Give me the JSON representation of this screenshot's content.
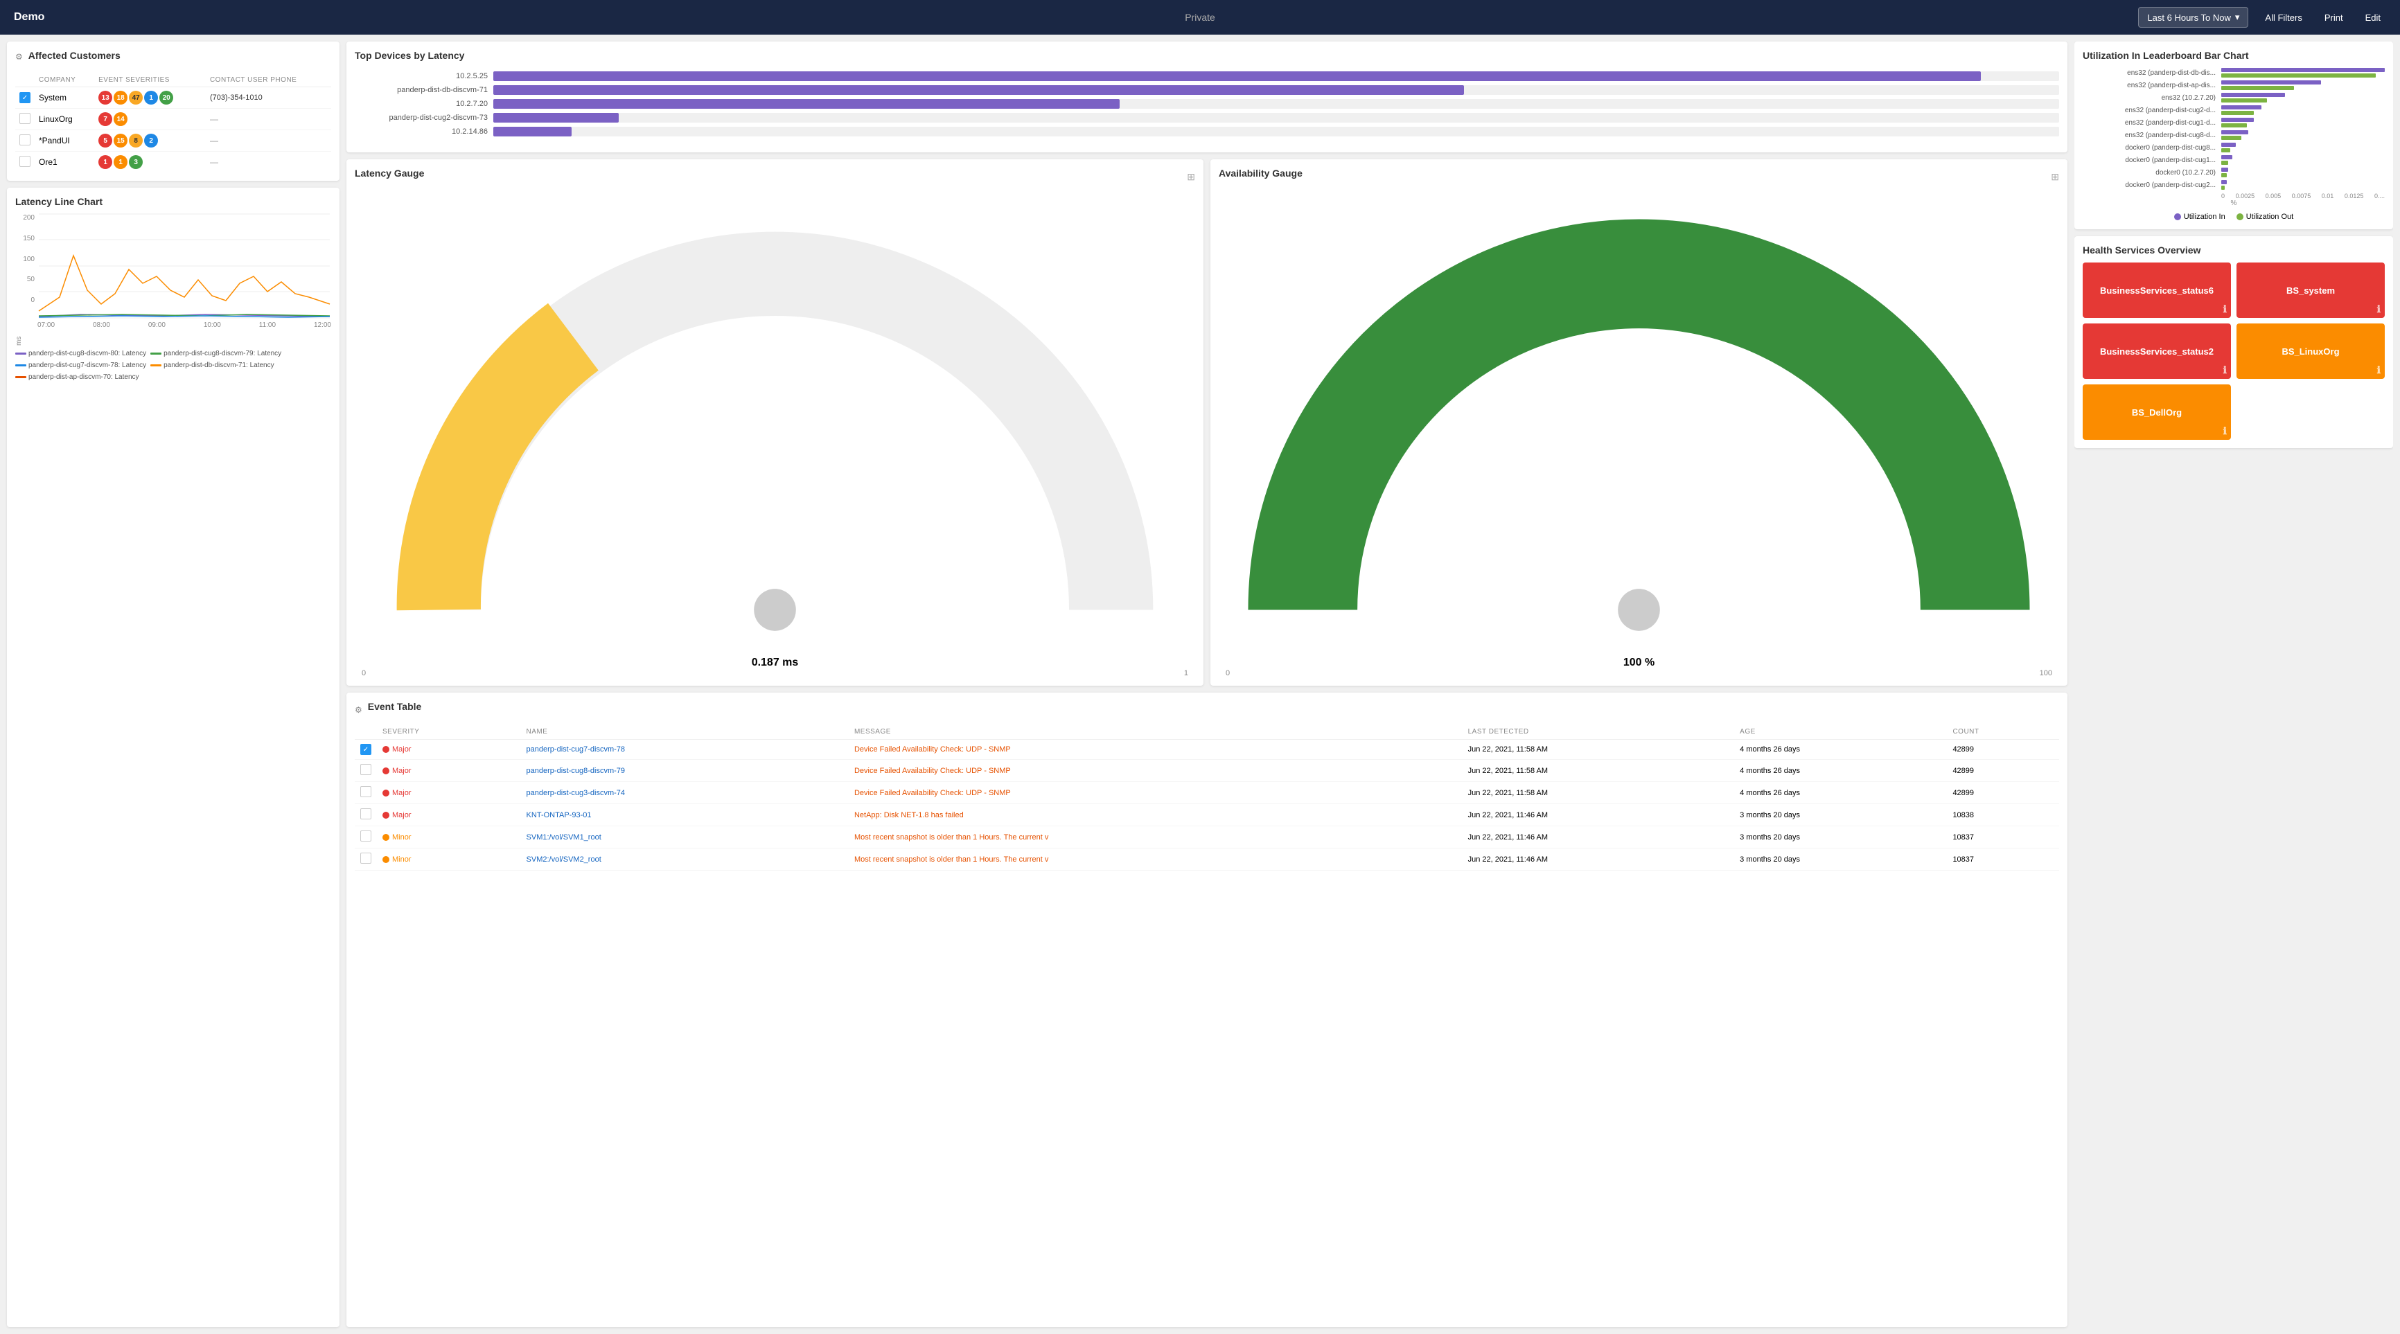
{
  "nav": {
    "title": "Demo",
    "private_label": "Private",
    "time_filter": "Last 6 Hours To Now",
    "all_filters": "All Filters",
    "print": "Print",
    "edit": "Edit"
  },
  "affected_customers": {
    "title": "Affected Customers",
    "columns": [
      "COMPANY",
      "EVENT SEVERITIES",
      "CONTACT USER PHONE"
    ],
    "rows": [
      {
        "checked": true,
        "company": "System",
        "badges": [
          {
            "count": "13",
            "color": "red"
          },
          {
            "count": "18",
            "color": "orange"
          },
          {
            "count": "47",
            "color": "yellow"
          },
          {
            "count": "1",
            "color": "blue"
          },
          {
            "count": "20",
            "color": "green"
          }
        ],
        "phone": "(703)-354-1010"
      },
      {
        "checked": false,
        "company": "LinuxOrg",
        "badges": [
          {
            "count": "7",
            "color": "red"
          },
          {
            "count": "14",
            "color": "orange"
          }
        ],
        "phone": "—"
      },
      {
        "checked": false,
        "company": "*PandUI",
        "badges": [
          {
            "count": "5",
            "color": "red"
          },
          {
            "count": "15",
            "color": "orange"
          },
          {
            "count": "8",
            "color": "yellow"
          },
          {
            "count": "2",
            "color": "blue"
          }
        ],
        "phone": "—"
      },
      {
        "checked": false,
        "company": "Ore1",
        "badges": [
          {
            "count": "1",
            "color": "red"
          },
          {
            "count": "1",
            "color": "orange"
          },
          {
            "count": "3",
            "color": "green"
          }
        ],
        "phone": "—"
      }
    ]
  },
  "top_devices": {
    "title": "Top Devices by Latency",
    "bars": [
      {
        "label": "10.2.5.25",
        "value": 95,
        "max": 100
      },
      {
        "label": "panderp-dist-db-discvm-71",
        "value": 62,
        "max": 100
      },
      {
        "label": "10.2.7.20",
        "value": 40,
        "max": 100
      },
      {
        "label": "panderp-dist-cug2-discvm-73",
        "value": 8,
        "max": 100
      },
      {
        "label": "10.2.14.86",
        "value": 5,
        "max": 100
      }
    ]
  },
  "utilization_chart": {
    "title": "Utilization In Leaderboard Bar Chart",
    "rows": [
      {
        "label": "ens32 (panderp-dist-db-dis...",
        "in": 90,
        "out": 85
      },
      {
        "label": "ens32 (panderp-dist-ap-dis...",
        "in": 55,
        "out": 40
      },
      {
        "label": "ens32 (10.2.7.20)",
        "in": 35,
        "out": 25
      },
      {
        "label": "ens32 (panderp-dist-cug2-d...",
        "in": 22,
        "out": 18
      },
      {
        "label": "ens32 (panderp-dist-cug1-d...",
        "in": 18,
        "out": 14
      },
      {
        "label": "ens32 (panderp-dist-cug8-d...",
        "in": 15,
        "out": 11
      },
      {
        "label": "docker0 (panderp-dist-cug8...",
        "in": 8,
        "out": 5
      },
      {
        "label": "docker0 (panderp-dist-cug1...",
        "in": 6,
        "out": 4
      },
      {
        "label": "docker0 (10.2.7.20)",
        "in": 4,
        "out": 3
      },
      {
        "label": "docker0 (panderp-dist-cug2...",
        "in": 3,
        "out": 2
      }
    ],
    "x_axis": [
      "0",
      "0.0025",
      "0.005",
      "0.0075",
      "0.01",
      "0.0125",
      "0...."
    ],
    "x_label": "%",
    "legend_in": "Utilization In",
    "legend_out": "Utilization Out"
  },
  "health_services": {
    "title": "Health Services Overview",
    "cards": [
      {
        "label": "BusinessServices_status6",
        "color": "red"
      },
      {
        "label": "BS_system",
        "color": "red"
      },
      {
        "label": "BusinessServices_status2",
        "color": "red"
      },
      {
        "label": "BS_LinuxOrg",
        "color": "orange"
      },
      {
        "label": "BS_DellOrg",
        "color": "orange"
      }
    ]
  },
  "latency_line": {
    "title": "Latency Line Chart",
    "y_axis": [
      "200",
      "150",
      "100",
      "50",
      "0"
    ],
    "y_label": "ms",
    "x_axis": [
      "07:00",
      "08:00",
      "09:00",
      "10:00",
      "11:00",
      "12:00"
    ],
    "legend": [
      {
        "label": "panderp-dist-cug8-discvm-80: Latency",
        "color": "#7b61c4"
      },
      {
        "label": "panderp-dist-cug8-discvm-79: Latency",
        "color": "#43a047"
      },
      {
        "label": "panderp-dist-cug7-discvm-78: Latency",
        "color": "#1e88e5"
      },
      {
        "label": "panderp-dist-db-discvm-71: Latency",
        "color": "#fb8c00"
      },
      {
        "label": "panderp-dist-ap-discvm-70: Latency",
        "color": "#e65100"
      }
    ]
  },
  "latency_gauge": {
    "title": "Latency Gauge",
    "value": "0.187 ms",
    "range_min": "0",
    "range_max": "1",
    "fill_pct": 18
  },
  "availability_gauge": {
    "title": "Availability Gauge",
    "value": "100 %",
    "range_min": "0",
    "range_max": "100",
    "fill_pct": 100
  },
  "event_table": {
    "title": "Event Table",
    "columns": [
      "SEVERITY",
      "NAME",
      "MESSAGE",
      "LAST DETECTED",
      "AGE",
      "COUNT"
    ],
    "rows": [
      {
        "checked": true,
        "severity": "Major",
        "severity_color": "#e53935",
        "name": "panderp-dist-cug7-discvm-78",
        "message": "Device Failed Availability Check: UDP - SNMP",
        "last_detected": "Jun 22, 2021, 11:58 AM",
        "age": "4 months 26 days",
        "count": "42899"
      },
      {
        "checked": false,
        "severity": "Major",
        "severity_color": "#e53935",
        "name": "panderp-dist-cug8-discvm-79",
        "message": "Device Failed Availability Check: UDP - SNMP",
        "last_detected": "Jun 22, 2021, 11:58 AM",
        "age": "4 months 26 days",
        "count": "42899"
      },
      {
        "checked": false,
        "severity": "Major",
        "severity_color": "#e53935",
        "name": "panderp-dist-cug3-discvm-74",
        "message": "Device Failed Availability Check: UDP - SNMP",
        "last_detected": "Jun 22, 2021, 11:58 AM",
        "age": "4 months 26 days",
        "count": "42899"
      },
      {
        "checked": false,
        "severity": "Major",
        "severity_color": "#e53935",
        "name": "KNT-ONTAP-93-01",
        "message": "NetApp: Disk NET-1.8 has failed",
        "last_detected": "Jun 22, 2021, 11:46 AM",
        "age": "3 months 20 days",
        "count": "10838"
      },
      {
        "checked": false,
        "severity": "Minor",
        "severity_color": "#fb8c00",
        "name": "SVM1:/vol/SVM1_root",
        "message": "Most recent snapshot is older than 1 Hours. The current v",
        "last_detected": "Jun 22, 2021, 11:46 AM",
        "age": "3 months 20 days",
        "count": "10837"
      },
      {
        "checked": false,
        "severity": "Minor",
        "severity_color": "#fb8c00",
        "name": "SVM2:/vol/SVM2_root",
        "message": "Most recent snapshot is older than 1 Hours. The current v",
        "last_detected": "Jun 22, 2021, 11:46 AM",
        "age": "3 months 20 days",
        "count": "10837"
      }
    ]
  }
}
